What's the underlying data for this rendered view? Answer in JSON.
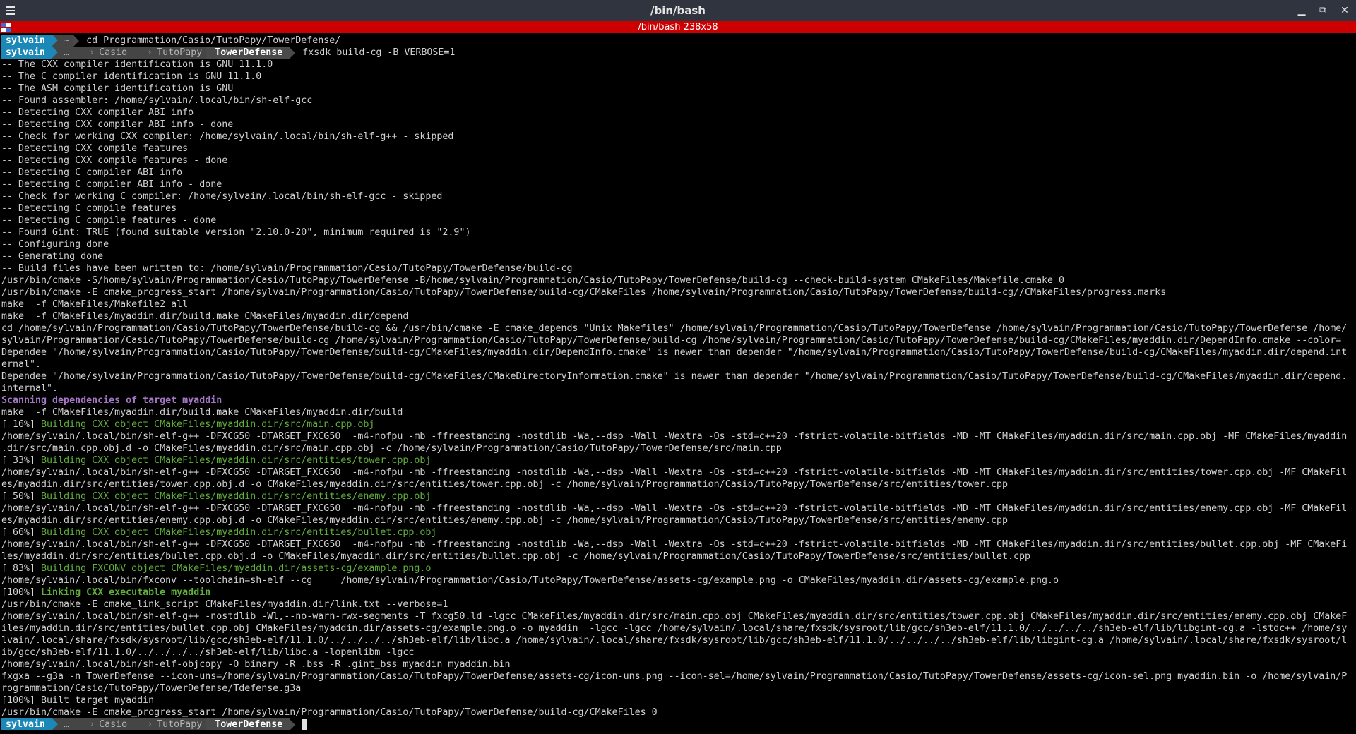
{
  "window": {
    "title": "/bin/bash",
    "tab_title": "/bin/bash 238x58",
    "controls": {
      "minimize": "▁",
      "restore": "⧉",
      "close": "✕"
    }
  },
  "colors": {
    "tab_bar": "#cc0000",
    "prompt_user_bg": "#1b88b8",
    "green_text": "#5fb13a",
    "purple_text": "#a676c7"
  },
  "prompts": [
    {
      "user": "sylvain",
      "path": [
        "~"
      ],
      "current": "",
      "command": "cd Programmation/Casio/TutoPapy/TowerDefense/"
    },
    {
      "user": "sylvain",
      "path": [
        "…",
        "Casio",
        "TutoPapy"
      ],
      "current": "TowerDefense",
      "command": "fxsdk build-cg -B VERBOSE=1"
    },
    {
      "user": "sylvain",
      "path": [
        "…",
        "Casio",
        "TutoPapy"
      ],
      "current": "TowerDefense",
      "command": ""
    }
  ],
  "output": [
    {
      "text": "-- The CXX compiler identification is GNU 11.1.0",
      "style": ""
    },
    {
      "text": "-- The C compiler identification is GNU 11.1.0",
      "style": ""
    },
    {
      "text": "-- The ASM compiler identification is GNU",
      "style": ""
    },
    {
      "text": "-- Found assembler: /home/sylvain/.local/bin/sh-elf-gcc",
      "style": ""
    },
    {
      "text": "-- Detecting CXX compiler ABI info",
      "style": ""
    },
    {
      "text": "-- Detecting CXX compiler ABI info - done",
      "style": ""
    },
    {
      "text": "-- Check for working CXX compiler: /home/sylvain/.local/bin/sh-elf-g++ - skipped",
      "style": ""
    },
    {
      "text": "-- Detecting CXX compile features",
      "style": ""
    },
    {
      "text": "-- Detecting CXX compile features - done",
      "style": ""
    },
    {
      "text": "-- Detecting C compiler ABI info",
      "style": ""
    },
    {
      "text": "-- Detecting C compiler ABI info - done",
      "style": ""
    },
    {
      "text": "-- Check for working C compiler: /home/sylvain/.local/bin/sh-elf-gcc - skipped",
      "style": ""
    },
    {
      "text": "-- Detecting C compile features",
      "style": ""
    },
    {
      "text": "-- Detecting C compile features - done",
      "style": ""
    },
    {
      "text": "-- Found Gint: TRUE (found suitable version \"2.10.0-20\", minimum required is \"2.9\")",
      "style": ""
    },
    {
      "text": "-- Configuring done",
      "style": ""
    },
    {
      "text": "-- Generating done",
      "style": ""
    },
    {
      "text": "-- Build files have been written to: /home/sylvain/Programmation/Casio/TutoPapy/TowerDefense/build-cg",
      "style": ""
    },
    {
      "text": "/usr/bin/cmake -S/home/sylvain/Programmation/Casio/TutoPapy/TowerDefense -B/home/sylvain/Programmation/Casio/TutoPapy/TowerDefense/build-cg --check-build-system CMakeFiles/Makefile.cmake 0",
      "style": ""
    },
    {
      "text": "/usr/bin/cmake -E cmake_progress_start /home/sylvain/Programmation/Casio/TutoPapy/TowerDefense/build-cg/CMakeFiles /home/sylvain/Programmation/Casio/TutoPapy/TowerDefense/build-cg//CMakeFiles/progress.marks",
      "style": ""
    },
    {
      "text": "make  -f CMakeFiles/Makefile2 all",
      "style": ""
    },
    {
      "text": "make  -f CMakeFiles/myaddin.dir/build.make CMakeFiles/myaddin.dir/depend",
      "style": ""
    },
    {
      "text": "cd /home/sylvain/Programmation/Casio/TutoPapy/TowerDefense/build-cg && /usr/bin/cmake -E cmake_depends \"Unix Makefiles\" /home/sylvain/Programmation/Casio/TutoPapy/TowerDefense /home/sylvain/Programmation/Casio/TutoPapy/TowerDefense /home/",
      "style": ""
    },
    {
      "text": "sylvain/Programmation/Casio/TutoPapy/TowerDefense/build-cg /home/sylvain/Programmation/Casio/TutoPapy/TowerDefense/build-cg /home/sylvain/Programmation/Casio/TutoPapy/TowerDefense/build-cg/CMakeFiles/myaddin.dir/DependInfo.cmake --color=",
      "style": ""
    },
    {
      "text": "Dependee \"/home/sylvain/Programmation/Casio/TutoPapy/TowerDefense/build-cg/CMakeFiles/myaddin.dir/DependInfo.cmake\" is newer than depender \"/home/sylvain/Programmation/Casio/TutoPapy/TowerDefense/build-cg/CMakeFiles/myaddin.dir/depend.int",
      "style": ""
    },
    {
      "text": "ernal\".",
      "style": ""
    },
    {
      "text": "Dependee \"/home/sylvain/Programmation/Casio/TutoPapy/TowerDefense/build-cg/CMakeFiles/CMakeDirectoryInformation.cmake\" is newer than depender \"/home/sylvain/Programmation/Casio/TutoPapy/TowerDefense/build-cg/CMakeFiles/myaddin.dir/depend.",
      "style": ""
    },
    {
      "text": "internal\".",
      "style": ""
    },
    {
      "text": "Scanning dependencies of target myaddin",
      "style": "purple bold"
    },
    {
      "text": "make  -f CMakeFiles/myaddin.dir/build.make CMakeFiles/myaddin.dir/build",
      "style": ""
    },
    {
      "prefix": "[ 16%] ",
      "text": "Building CXX object CMakeFiles/myaddin.dir/src/main.cpp.obj",
      "style": "green"
    },
    {
      "text": "/home/sylvain/.local/bin/sh-elf-g++ -DFXCG50 -DTARGET_FXCG50  -m4-nofpu -mb -ffreestanding -nostdlib -Wa,--dsp -Wall -Wextra -Os -std=c++20 -fstrict-volatile-bitfields -MD -MT CMakeFiles/myaddin.dir/src/main.cpp.obj -MF CMakeFiles/myaddin",
      "style": ""
    },
    {
      "text": ".dir/src/main.cpp.obj.d -o CMakeFiles/myaddin.dir/src/main.cpp.obj -c /home/sylvain/Programmation/Casio/TutoPapy/TowerDefense/src/main.cpp",
      "style": ""
    },
    {
      "prefix": "[ 33%] ",
      "text": "Building CXX object CMakeFiles/myaddin.dir/src/entities/tower.cpp.obj",
      "style": "green"
    },
    {
      "text": "/home/sylvain/.local/bin/sh-elf-g++ -DFXCG50 -DTARGET_FXCG50  -m4-nofpu -mb -ffreestanding -nostdlib -Wa,--dsp -Wall -Wextra -Os -std=c++20 -fstrict-volatile-bitfields -MD -MT CMakeFiles/myaddin.dir/src/entities/tower.cpp.obj -MF CMakeFil",
      "style": ""
    },
    {
      "text": "es/myaddin.dir/src/entities/tower.cpp.obj.d -o CMakeFiles/myaddin.dir/src/entities/tower.cpp.obj -c /home/sylvain/Programmation/Casio/TutoPapy/TowerDefense/src/entities/tower.cpp",
      "style": ""
    },
    {
      "prefix": "[ 50%] ",
      "text": "Building CXX object CMakeFiles/myaddin.dir/src/entities/enemy.cpp.obj",
      "style": "green"
    },
    {
      "text": "/home/sylvain/.local/bin/sh-elf-g++ -DFXCG50 -DTARGET_FXCG50  -m4-nofpu -mb -ffreestanding -nostdlib -Wa,--dsp -Wall -Wextra -Os -std=c++20 -fstrict-volatile-bitfields -MD -MT CMakeFiles/myaddin.dir/src/entities/enemy.cpp.obj -MF CMakeFil",
      "style": ""
    },
    {
      "text": "es/myaddin.dir/src/entities/enemy.cpp.obj.d -o CMakeFiles/myaddin.dir/src/entities/enemy.cpp.obj -c /home/sylvain/Programmation/Casio/TutoPapy/TowerDefense/src/entities/enemy.cpp",
      "style": ""
    },
    {
      "prefix": "[ 66%] ",
      "text": "Building CXX object CMakeFiles/myaddin.dir/src/entities/bullet.cpp.obj",
      "style": "green"
    },
    {
      "text": "/home/sylvain/.local/bin/sh-elf-g++ -DFXCG50 -DTARGET_FXCG50  -m4-nofpu -mb -ffreestanding -nostdlib -Wa,--dsp -Wall -Wextra -Os -std=c++20 -fstrict-volatile-bitfields -MD -MT CMakeFiles/myaddin.dir/src/entities/bullet.cpp.obj -MF CMakeFi",
      "style": ""
    },
    {
      "text": "les/myaddin.dir/src/entities/bullet.cpp.obj.d -o CMakeFiles/myaddin.dir/src/entities/bullet.cpp.obj -c /home/sylvain/Programmation/Casio/TutoPapy/TowerDefense/src/entities/bullet.cpp",
      "style": ""
    },
    {
      "prefix": "[ 83%] ",
      "text": "Building FXCONV object CMakeFiles/myaddin.dir/assets-cg/example.png.o",
      "style": "green"
    },
    {
      "text": "/home/sylvain/.local/bin/fxconv --toolchain=sh-elf --cg     /home/sylvain/Programmation/Casio/TutoPapy/TowerDefense/assets-cg/example.png -o CMakeFiles/myaddin.dir/assets-cg/example.png.o",
      "style": ""
    },
    {
      "prefix": "[100%] ",
      "text": "Linking CXX executable myaddin",
      "style": "green bold"
    },
    {
      "text": "/usr/bin/cmake -E cmake_link_script CMakeFiles/myaddin.dir/link.txt --verbose=1",
      "style": ""
    },
    {
      "text": "/home/sylvain/.local/bin/sh-elf-g++ -nostdlib -Wl,--no-warn-rwx-segments -T fxcg50.ld -lgcc CMakeFiles/myaddin.dir/src/main.cpp.obj CMakeFiles/myaddin.dir/src/entities/tower.cpp.obj CMakeFiles/myaddin.dir/src/entities/enemy.cpp.obj CMakeF",
      "style": ""
    },
    {
      "text": "iles/myaddin.dir/src/entities/bullet.cpp.obj CMakeFiles/myaddin.dir/assets-cg/example.png.o -o myaddin  -lgcc -lgcc /home/sylvain/.local/share/fxsdk/sysroot/lib/gcc/sh3eb-elf/11.1.0/../../../../sh3eb-elf/lib/libgint-cg.a -lstdc++ /home/sy",
      "style": ""
    },
    {
      "text": "lvain/.local/share/fxsdk/sysroot/lib/gcc/sh3eb-elf/11.1.0/../../../../sh3eb-elf/lib/libc.a /home/sylvain/.local/share/fxsdk/sysroot/lib/gcc/sh3eb-elf/11.1.0/../../../../sh3eb-elf/lib/libgint-cg.a /home/sylvain/.local/share/fxsdk/sysroot/l",
      "style": ""
    },
    {
      "text": "ib/gcc/sh3eb-elf/11.1.0/../../../../sh3eb-elf/lib/libc.a -lopenlibm -lgcc",
      "style": ""
    },
    {
      "text": "/home/sylvain/.local/bin/sh-elf-objcopy -O binary -R .bss -R .gint_bss myaddin myaddin.bin",
      "style": ""
    },
    {
      "text": "fxgxa --g3a -n TowerDefense --icon-uns=/home/sylvain/Programmation/Casio/TutoPapy/TowerDefense/assets-cg/icon-uns.png --icon-sel=/home/sylvain/Programmation/Casio/TutoPapy/TowerDefense/assets-cg/icon-sel.png myaddin.bin -o /home/sylvain/P",
      "style": ""
    },
    {
      "text": "rogrammation/Casio/TutoPapy/TowerDefense/Tdefense.g3a",
      "style": ""
    },
    {
      "text": "[100%] Built target myaddin",
      "style": ""
    },
    {
      "text": "/usr/bin/cmake -E cmake_progress_start /home/sylvain/Programmation/Casio/TutoPapy/TowerDefense/build-cg/CMakeFiles 0",
      "style": ""
    }
  ]
}
